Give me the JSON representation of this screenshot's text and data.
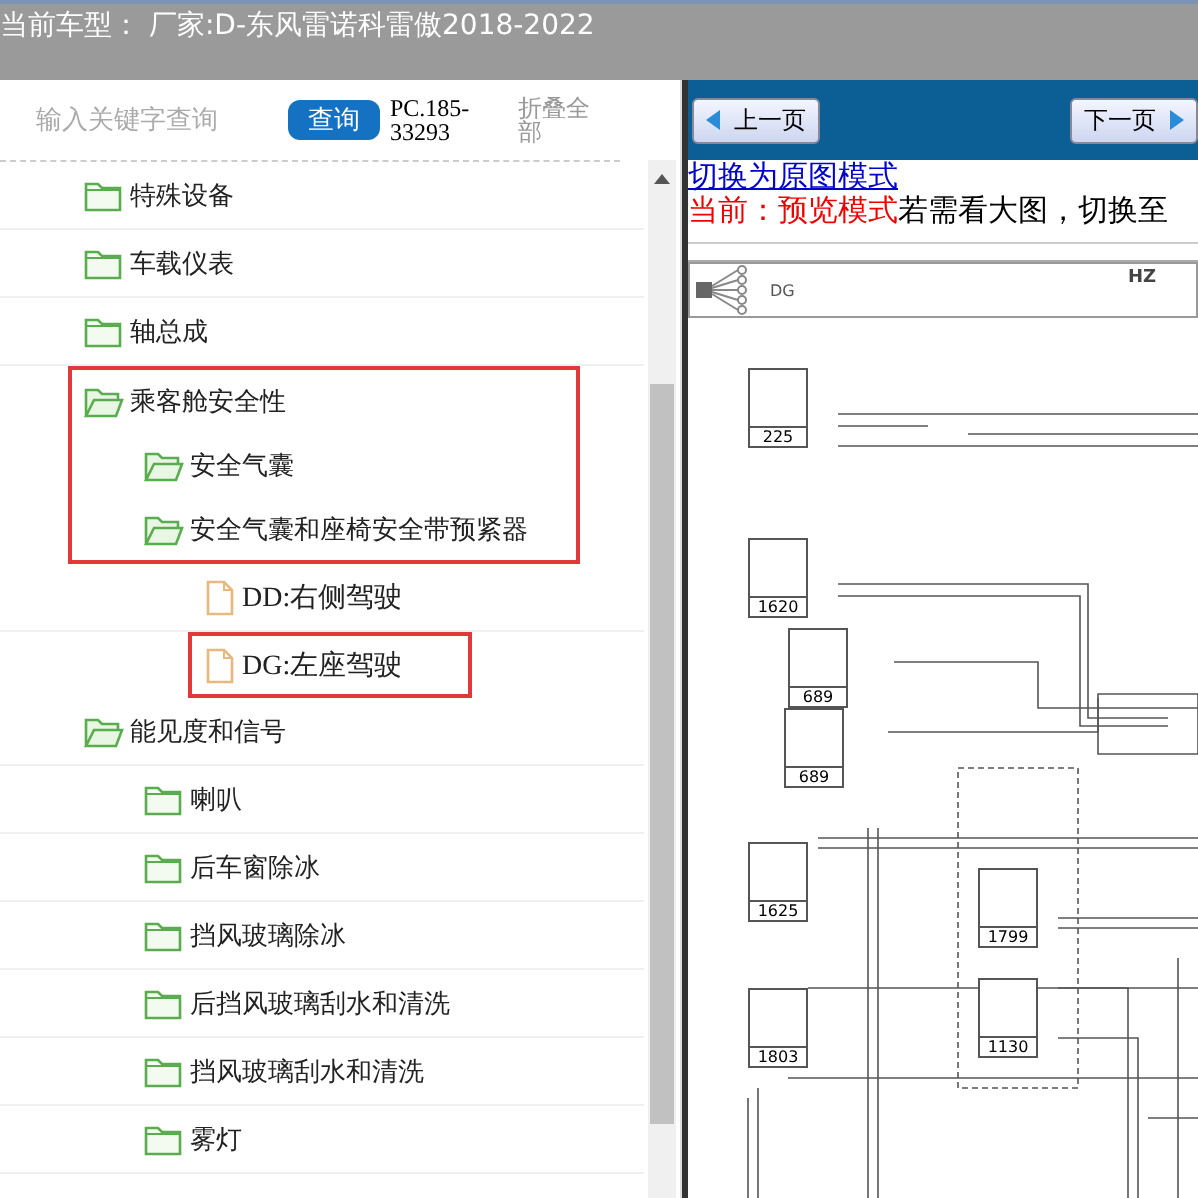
{
  "header": {
    "title": "当前车型： 厂家:D-东风雷诺科雷傲2018-2022"
  },
  "search": {
    "placeholder": "输入关键字查询",
    "button": "查询",
    "code": "PC.185-33293",
    "collapse_link": "折叠全部"
  },
  "tree": [
    {
      "label": "特殊设备",
      "kind": "folder",
      "expanded": false,
      "highlighted": false
    },
    {
      "label": "车载仪表",
      "kind": "folder",
      "expanded": false,
      "highlighted": false
    },
    {
      "label": "轴总成",
      "kind": "folder",
      "expanded": false,
      "highlighted": false
    },
    {
      "label": "乘客舱安全性",
      "kind": "folder",
      "expanded": true,
      "highlighted": true,
      "children": [
        {
          "label": "安全气囊",
          "kind": "folder",
          "expanded": true,
          "highlighted": true
        },
        {
          "label": "安全气囊和座椅安全带预紧器",
          "kind": "folder",
          "expanded": true,
          "highlighted": true,
          "children": [
            {
              "label": "DD:右侧驾驶",
              "kind": "file",
              "highlighted": false
            },
            {
              "label": "DG:左座驾驶",
              "kind": "file",
              "highlighted": true
            }
          ]
        }
      ]
    },
    {
      "label": "能见度和信号",
      "kind": "folder",
      "expanded": true,
      "highlighted": false,
      "children": [
        {
          "label": "喇叭",
          "kind": "folder",
          "expanded": false,
          "highlighted": false
        },
        {
          "label": "后车窗除冰",
          "kind": "folder",
          "expanded": false,
          "highlighted": false
        },
        {
          "label": "挡风玻璃除冰",
          "kind": "folder",
          "expanded": false,
          "highlighted": false
        },
        {
          "label": "后挡风玻璃刮水和清洗",
          "kind": "folder",
          "expanded": false,
          "highlighted": false
        },
        {
          "label": "挡风玻璃刮水和清洗",
          "kind": "folder",
          "expanded": false,
          "highlighted": false
        },
        {
          "label": "雾灯",
          "kind": "folder",
          "expanded": false,
          "highlighted": false
        }
      ]
    }
  ],
  "viewer": {
    "prev_button": "上一页",
    "next_button": "下一页",
    "mode_link": "切换为原图模式",
    "mode_status": "当前：预览模式",
    "mode_hint": "若需看大图，切换至",
    "diagram": {
      "header_label": "DG",
      "corner_label": "HZ",
      "components": [
        {
          "label": "225"
        },
        {
          "label": "1620"
        },
        {
          "label": "689"
        },
        {
          "label": "689"
        },
        {
          "label": "1625"
        },
        {
          "label": "1799"
        },
        {
          "label": "1130"
        },
        {
          "label": "1803"
        }
      ]
    }
  }
}
